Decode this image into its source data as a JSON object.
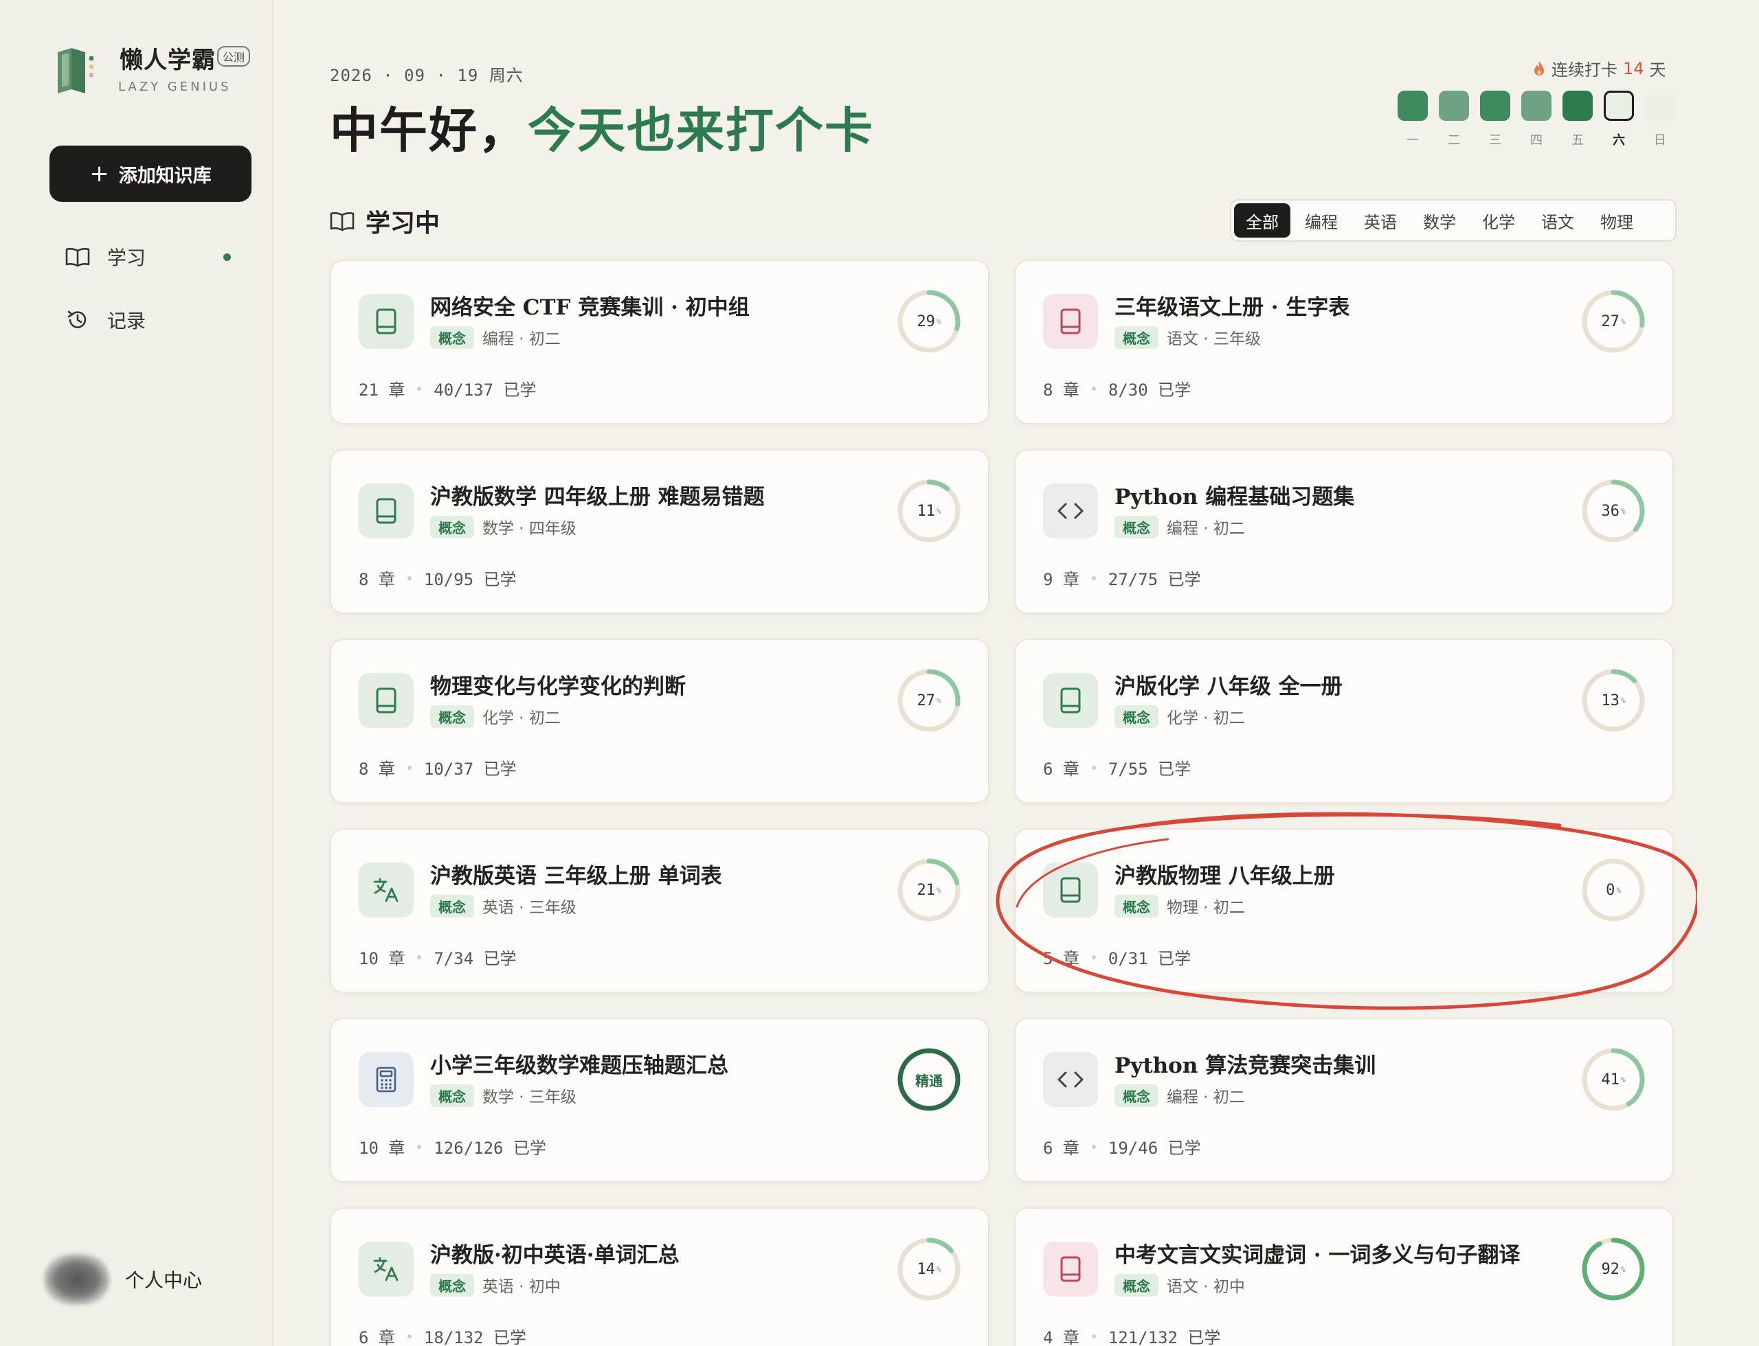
{
  "brand": {
    "name": "懒人学霸",
    "badge": "公测",
    "subtitle": "LAZY GENIUS"
  },
  "sidebar": {
    "add_label": "添加知识库",
    "nav": [
      {
        "label": "学习",
        "icon": "book-open-icon",
        "active": true
      },
      {
        "label": "记录",
        "icon": "history-icon",
        "active": false
      }
    ],
    "profile_label": "个人中心"
  },
  "header": {
    "date": "2026 · 09 · 19  周六",
    "greeting_prefix": "中午好，",
    "greeting_accent": "今天也来打个卡",
    "streak_prefix": "连续打卡",
    "streak_days": "14",
    "streak_suffix": "天"
  },
  "week": [
    {
      "label": "一",
      "color": "#3f8a5f"
    },
    {
      "label": "二",
      "color": "#6da383"
    },
    {
      "label": "三",
      "color": "#3f8a5f"
    },
    {
      "label": "四",
      "color": "#6da383"
    },
    {
      "label": "五",
      "color": "#2c7a4d"
    },
    {
      "label": "六",
      "color": "#e6efe2",
      "today": true
    },
    {
      "label": "日",
      "color": "#f1eee7"
    }
  ],
  "section": {
    "title": "学习中"
  },
  "tabs": [
    "全部",
    "编程",
    "英语",
    "数学",
    "化学",
    "语文",
    "物理"
  ],
  "active_tab": "全部",
  "cards": [
    {
      "title": "网络安全 CTF 竞赛集训 · 初中组",
      "tag": "概念",
      "meta": "编程 · 初二",
      "chapters": "21 章",
      "progress": "40/137 已学",
      "percent": 29,
      "icon": "book-icon",
      "icon_bg": "#e3ede4",
      "icon_color": "#2f7a4f"
    },
    {
      "title": "三年级语文上册 · 生字表",
      "tag": "概念",
      "meta": "语文 · 三年级",
      "chapters": "8 章",
      "progress": "8/30 已学",
      "percent": 27,
      "icon": "book-icon",
      "icon_bg": "#f6e4e6",
      "icon_color": "#b84a5c"
    },
    {
      "title": "沪教版数学 四年级上册 难题易错题",
      "tag": "概念",
      "meta": "数学 · 四年级",
      "chapters": "8 章",
      "progress": "10/95 已学",
      "percent": 11,
      "icon": "book-icon",
      "icon_bg": "#e3ede4",
      "icon_color": "#2f7a4f"
    },
    {
      "title": "Python 编程基础习题集",
      "tag": "概念",
      "meta": "编程 · 初二",
      "chapters": "9 章",
      "progress": "27/75 已学",
      "percent": 36,
      "icon": "code-icon",
      "icon_bg": "#ecebe7",
      "icon_color": "#444"
    },
    {
      "title": "物理变化与化学变化的判断",
      "tag": "概念",
      "meta": "化学 · 初二",
      "chapters": "8 章",
      "progress": "10/37 已学",
      "percent": 27,
      "icon": "book-icon",
      "icon_bg": "#e3ede4",
      "icon_color": "#2f7a4f"
    },
    {
      "title": "沪版化学 八年级 全一册",
      "tag": "概念",
      "meta": "化学 · 初二",
      "chapters": "6 章",
      "progress": "7/55 已学",
      "percent": 13,
      "icon": "book-icon",
      "icon_bg": "#e3ede4",
      "icon_color": "#2f7a4f"
    },
    {
      "title": "沪教版英语 三年级上册 单词表",
      "tag": "概念",
      "meta": "英语 · 三年级",
      "chapters": "10 章",
      "progress": "7/34 已学",
      "percent": 21,
      "icon": "translate-icon",
      "icon_bg": "#e3ede4",
      "icon_color": "#2f7a4f"
    },
    {
      "title": "沪教版物理 八年级上册",
      "tag": "概念",
      "meta": "物理 · 初二",
      "chapters": "5 章",
      "progress": "0/31 已学",
      "percent": 0,
      "icon": "book-icon",
      "icon_bg": "#e3ede4",
      "icon_color": "#2f7a4f"
    },
    {
      "title": "小学三年级数学难题压轴题汇总",
      "tag": "概念",
      "meta": "数学 · 三年级",
      "chapters": "10 章",
      "progress": "126/126 已学",
      "percent": 100,
      "ring_text": "精通",
      "icon": "calculator-icon",
      "icon_bg": "#e6ebf2",
      "icon_color": "#4a5f86"
    },
    {
      "title": "Python 算法竞赛突击集训",
      "tag": "概念",
      "meta": "编程 · 初二",
      "chapters": "6 章",
      "progress": "19/46 已学",
      "percent": 41,
      "icon": "code-icon",
      "icon_bg": "#ecebe7",
      "icon_color": "#444"
    },
    {
      "title": "沪教版·初中英语·单词汇总",
      "tag": "概念",
      "meta": "英语 · 初中",
      "chapters": "6 章",
      "progress": "18/132 已学",
      "percent": 14,
      "icon": "translate-icon",
      "icon_bg": "#e3ede4",
      "icon_color": "#2f7a4f"
    },
    {
      "title": "中考文言文实词虚词 · 一词多义与句子翻译",
      "tag": "概念",
      "meta": "语文 · 初中",
      "chapters": "4 章",
      "progress": "121/132 已学",
      "percent": 92,
      "icon": "book-icon",
      "icon_bg": "#f6e4e6",
      "icon_color": "#b84a5c"
    }
  ],
  "colors": {
    "accent": "#2c7a4d",
    "ring_track": "#e7e1d3",
    "ring_fill": "#8fc7a0",
    "ring_mastered": "#2c6a4a",
    "annotation": "#d8483a"
  }
}
